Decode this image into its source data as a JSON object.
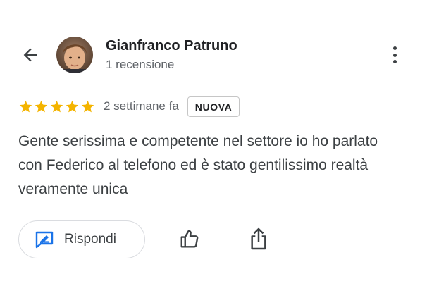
{
  "header": {
    "back_icon": "arrow-back-icon",
    "more_icon": "more-vertical-icon"
  },
  "author": {
    "name": "Gianfranco Patruno",
    "reviews_count_text": "1 recensione",
    "avatar": "profile-photo"
  },
  "review": {
    "rating": 5,
    "rating_max": 5,
    "time_ago": "2 settimane fa",
    "badge": "NUOVA",
    "text": "Gente serissima e competente nel settore io ho parlato con Federico al telefono ed è stato gentilissimo realtà veramente unica"
  },
  "actions": {
    "reply_label": "Rispondi",
    "reply_icon": "reply-icon",
    "like_icon": "thumbs-up-icon",
    "share_icon": "share-icon"
  },
  "colors": {
    "star": "#F4B400",
    "accent": "#1A73E8",
    "text_primary": "#202124",
    "text_secondary": "#5F6368"
  }
}
